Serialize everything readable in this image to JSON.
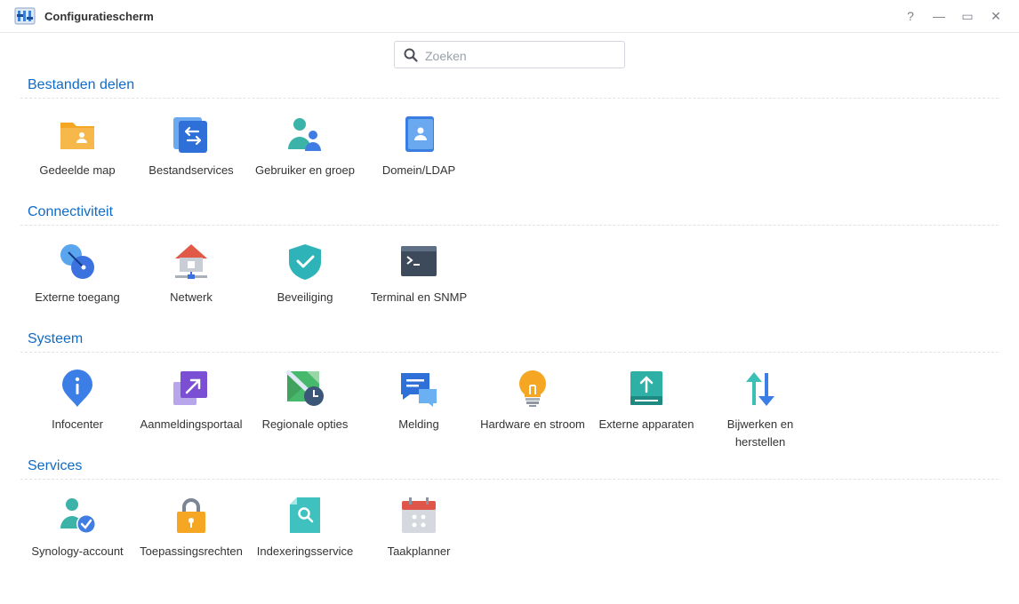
{
  "window": {
    "title": "Configuratiescherm",
    "buttons": {
      "help": "?",
      "minimize": "—",
      "maximize": "▭",
      "close": "✕"
    }
  },
  "search": {
    "placeholder": "Zoeken",
    "value": ""
  },
  "sections": [
    {
      "title": "Bestanden delen",
      "items": [
        {
          "label": "Gedeelde map",
          "icon": "shared-folder-icon"
        },
        {
          "label": "Bestandservices",
          "icon": "file-services-icon"
        },
        {
          "label": "Gebruiker en groep",
          "icon": "user-group-icon"
        },
        {
          "label": "Domein/LDAP",
          "icon": "domain-ldap-icon"
        }
      ]
    },
    {
      "title": "Connectiviteit",
      "items": [
        {
          "label": "Externe toegang",
          "icon": "external-access-icon"
        },
        {
          "label": "Netwerk",
          "icon": "network-icon"
        },
        {
          "label": "Beveiliging",
          "icon": "security-shield-icon"
        },
        {
          "label": "Terminal en SNMP",
          "icon": "terminal-icon"
        }
      ]
    },
    {
      "title": "Systeem",
      "items": [
        {
          "label": "Infocenter",
          "icon": "info-center-icon"
        },
        {
          "label": "Aanmeldingsportaal",
          "icon": "login-portal-icon"
        },
        {
          "label": "Regionale opties",
          "icon": "regional-options-icon"
        },
        {
          "label": "Melding",
          "icon": "notification-icon"
        },
        {
          "label": "Hardware en stroom",
          "icon": "hardware-power-icon"
        },
        {
          "label": "Externe apparaten",
          "icon": "external-devices-icon"
        },
        {
          "label": "Bijwerken en herstellen",
          "icon": "update-restore-icon"
        }
      ]
    },
    {
      "title": "Services",
      "items": [
        {
          "label": "Synology-account",
          "icon": "synology-account-icon"
        },
        {
          "label": "Toepassingsrechten",
          "icon": "application-privileges-icon"
        },
        {
          "label": "Indexeringsservice",
          "icon": "indexing-service-icon"
        },
        {
          "label": "Taakplanner",
          "icon": "task-scheduler-icon"
        }
      ]
    }
  ]
}
